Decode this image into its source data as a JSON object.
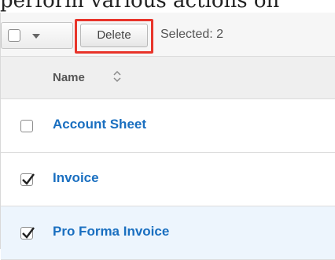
{
  "page": {
    "partial_text": "perform various actions on"
  },
  "toolbar": {
    "delete_label": "Delete",
    "selected_label": "Selected: 2"
  },
  "table": {
    "column_header": "Name",
    "rows": [
      {
        "name": "Account Sheet",
        "checked": false
      },
      {
        "name": "Invoice",
        "checked": true
      },
      {
        "name": "Pro Forma Invoice",
        "checked": true
      }
    ]
  },
  "colors": {
    "link": "#1a6fc0",
    "highlight_border": "#e8342a",
    "selected_row_bg": "#edf5fd"
  },
  "icons": [
    "chevron-down-icon",
    "sort-icon",
    "checkmark-icon"
  ]
}
